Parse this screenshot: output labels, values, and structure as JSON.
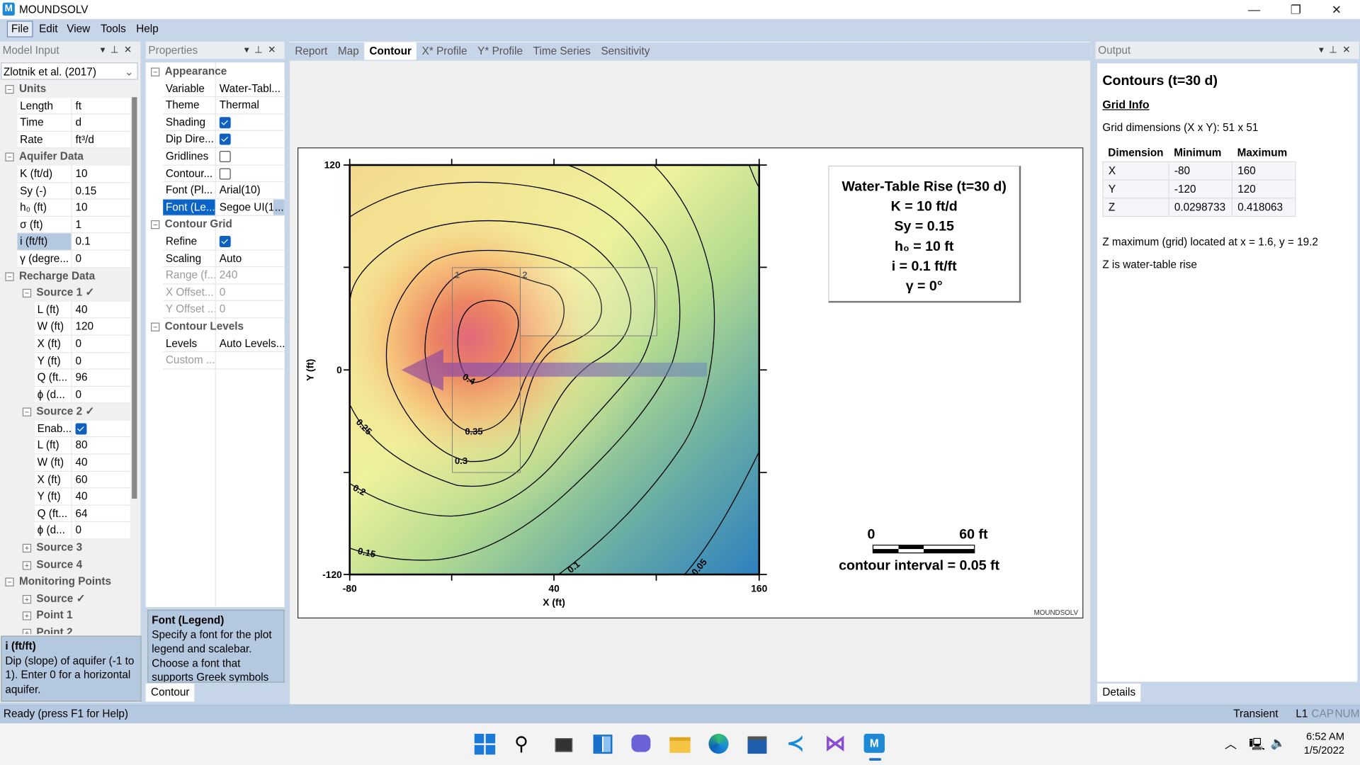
{
  "app": {
    "title": "MOUNDSOLV",
    "window_controls": [
      "minimize",
      "restore",
      "close"
    ]
  },
  "menu": [
    "File",
    "Edit",
    "View",
    "Tools",
    "Help"
  ],
  "model_input": {
    "header": "Model Input",
    "scenario": "Zlotnik et al. (2017)",
    "rows": [
      {
        "kind": "group",
        "depth": 0,
        "label": "Units",
        "expanded": true
      },
      {
        "kind": "prop",
        "depth": 1,
        "label": "Length",
        "value": "ft"
      },
      {
        "kind": "prop",
        "depth": 1,
        "label": "Time",
        "value": "d"
      },
      {
        "kind": "prop",
        "depth": 1,
        "label": "Rate",
        "value": "ft³/d"
      },
      {
        "kind": "group",
        "depth": 0,
        "label": "Aquifer Data",
        "expanded": true
      },
      {
        "kind": "prop",
        "depth": 1,
        "label": "K (ft/d)",
        "value": "10"
      },
      {
        "kind": "prop",
        "depth": 1,
        "label": "Sy (-)",
        "value": "0.15"
      },
      {
        "kind": "prop",
        "depth": 1,
        "label": "h₀ (ft)",
        "value": "10"
      },
      {
        "kind": "prop",
        "depth": 1,
        "label": "σ (ft)",
        "value": "1"
      },
      {
        "kind": "prop",
        "depth": 1,
        "label": "i (ft/ft)",
        "value": "0.1",
        "selected": true
      },
      {
        "kind": "prop",
        "depth": 1,
        "label": "γ (degre...",
        "value": "0"
      },
      {
        "kind": "group",
        "depth": 0,
        "label": "Recharge Data",
        "expanded": true
      },
      {
        "kind": "group",
        "depth": 1,
        "label": "Source 1 ✓",
        "expanded": true
      },
      {
        "kind": "prop",
        "depth": 2,
        "label": "L (ft)",
        "value": "40"
      },
      {
        "kind": "prop",
        "depth": 2,
        "label": "W (ft)",
        "value": "120"
      },
      {
        "kind": "prop",
        "depth": 2,
        "label": "X (ft)",
        "value": "0"
      },
      {
        "kind": "prop",
        "depth": 2,
        "label": "Y (ft)",
        "value": "0"
      },
      {
        "kind": "prop",
        "depth": 2,
        "label": "Q (ft...",
        "value": "96"
      },
      {
        "kind": "prop",
        "depth": 2,
        "label": "ϕ (d...",
        "value": "0"
      },
      {
        "kind": "group",
        "depth": 1,
        "label": "Source 2 ✓",
        "expanded": true
      },
      {
        "kind": "check",
        "depth": 2,
        "label": "Enab...",
        "checked": true
      },
      {
        "kind": "prop",
        "depth": 2,
        "label": "L (ft)",
        "value": "80"
      },
      {
        "kind": "prop",
        "depth": 2,
        "label": "W (ft)",
        "value": "40"
      },
      {
        "kind": "prop",
        "depth": 2,
        "label": "X (ft)",
        "value": "60"
      },
      {
        "kind": "prop",
        "depth": 2,
        "label": "Y (ft)",
        "value": "40"
      },
      {
        "kind": "prop",
        "depth": 2,
        "label": "Q (ft...",
        "value": "64"
      },
      {
        "kind": "prop",
        "depth": 2,
        "label": "ϕ (d...",
        "value": "0"
      },
      {
        "kind": "group",
        "depth": 1,
        "label": "Source 3",
        "expanded": false
      },
      {
        "kind": "group",
        "depth": 1,
        "label": "Source 4",
        "expanded": false
      },
      {
        "kind": "group",
        "depth": 0,
        "label": "Monitoring Points",
        "expanded": true
      },
      {
        "kind": "group",
        "depth": 1,
        "label": "Source ✓",
        "expanded": false
      },
      {
        "kind": "group",
        "depth": 1,
        "label": "Point 1",
        "expanded": false
      },
      {
        "kind": "group",
        "depth": 1,
        "label": "Point 2",
        "expanded": false
      }
    ],
    "description_title": "i (ft/ft)",
    "description": "Dip (slope) of aquifer (-1 to 1). Enter 0 for a horizontal aquifer."
  },
  "properties": {
    "header": "Properties",
    "rows": [
      {
        "kind": "group",
        "depth": 0,
        "label": "Appearance",
        "expanded": true
      },
      {
        "kind": "prop",
        "depth": 1,
        "label": "Variable",
        "value": "Water-Tabl..."
      },
      {
        "kind": "prop",
        "depth": 1,
        "label": "Theme",
        "value": "Thermal"
      },
      {
        "kind": "check",
        "depth": 1,
        "label": "Shading",
        "checked": true
      },
      {
        "kind": "check",
        "depth": 1,
        "label": "Dip Dire...",
        "checked": true
      },
      {
        "kind": "check",
        "depth": 1,
        "label": "Gridlines",
        "checked": false
      },
      {
        "kind": "check",
        "depth": 1,
        "label": "Contour...",
        "checked": false
      },
      {
        "kind": "prop",
        "depth": 1,
        "label": "Font (Pl...",
        "value": "Arial(10)"
      },
      {
        "kind": "prop",
        "depth": 1,
        "label": "Font (Le...",
        "value": "Segoe UI(1",
        "selected_blue": true,
        "button": "..."
      },
      {
        "kind": "group",
        "depth": 0,
        "label": "Contour Grid",
        "expanded": true
      },
      {
        "kind": "check",
        "depth": 1,
        "label": "Refine",
        "checked": true
      },
      {
        "kind": "prop",
        "depth": 1,
        "label": "Scaling",
        "value": "Auto"
      },
      {
        "kind": "prop",
        "depth": 1,
        "label": "Range (f...",
        "value": "240",
        "disabled": true
      },
      {
        "kind": "prop",
        "depth": 1,
        "label": "X Offset...",
        "value": "0",
        "disabled": true
      },
      {
        "kind": "prop",
        "depth": 1,
        "label": "Y Offset ...",
        "value": "0",
        "disabled": true
      },
      {
        "kind": "group",
        "depth": 0,
        "label": "Contour Levels",
        "expanded": true
      },
      {
        "kind": "prop",
        "depth": 1,
        "label": "Levels",
        "value": "Auto Levels..."
      },
      {
        "kind": "prop",
        "depth": 1,
        "label": "Custom ...",
        "value": "",
        "disabled": true
      }
    ],
    "description_title": "Font (Legend)",
    "description": "Specify a font for the plot legend and scalebar. Choose a font that supports Greek symbols (default is",
    "bottom_tab": "Contour"
  },
  "document_tabs": [
    {
      "label": "Report",
      "active": false
    },
    {
      "label": "Map",
      "active": false
    },
    {
      "label": "Contour",
      "active": true
    },
    {
      "label": "X* Profile",
      "active": false
    },
    {
      "label": "Y* Profile",
      "active": false
    },
    {
      "label": "Time Series",
      "active": false
    },
    {
      "label": "Sensitivity",
      "active": false
    }
  ],
  "chart_data": {
    "type": "contour",
    "xlabel": "X (ft)",
    "ylabel": "Y (ft)",
    "xlim": [
      -80,
      160
    ],
    "ylim": [
      -120,
      120
    ],
    "x_tick_labels": [
      "-80",
      "40",
      "160"
    ],
    "y_tick_labels": [
      "120",
      "0",
      "-120"
    ],
    "contour_levels": [
      0.05,
      0.1,
      0.15,
      0.2,
      0.25,
      0.3,
      0.35,
      0.4
    ],
    "contour_labels": [
      "0.4",
      "0.35",
      "0.3",
      "0.25",
      "0.2",
      "0.15",
      "0.1",
      "0.05"
    ],
    "z_max_location": {
      "x": 1.6,
      "y": 19.2
    },
    "z_range": [
      0.0298733,
      0.418063
    ],
    "colormap": "Thermal",
    "shading": true,
    "gridlines": false,
    "sources": [
      {
        "label": "1",
        "x_range": [
          -20,
          20
        ],
        "y_range": [
          -60,
          60
        ]
      },
      {
        "label": "2",
        "x_range": [
          20,
          100
        ],
        "y_range": [
          20,
          60
        ]
      }
    ],
    "dip_direction": "toward -x (arrow along y = 0)",
    "legend": {
      "lines": [
        "Water-Table Rise (t=30 d)",
        "K = 10 ft/d",
        "Sy = 0.15",
        "h₀ = 10 ft",
        "i = 0.1 ft/ft",
        "γ = 0°"
      ],
      "placement": "top-right"
    },
    "scalebar": {
      "start": "0",
      "end": "60 ft"
    },
    "contour_interval_text": "contour interval = 0.05 ft",
    "watermark": "MOUNDSOLV"
  },
  "output": {
    "header": "Output",
    "title": "Contours (t=30 d)",
    "section": "Grid Info",
    "grid_dims": "Grid dimensions (X x Y): 51 x 51",
    "table": {
      "headers": [
        "Dimension",
        "Minimum",
        "Maximum"
      ],
      "rows": [
        [
          "X",
          "-80",
          "160"
        ],
        [
          "Y",
          "-120",
          "120"
        ],
        [
          "Z",
          "0.0298733",
          "0.418063"
        ]
      ]
    },
    "zmax_text": "Z maximum (grid) located at x = 1.6, y = 19.2",
    "z_note": "Z is water-table rise",
    "bottom_tab": "Details"
  },
  "status": {
    "text": "Ready (press F1 for Help)",
    "mode": "Transient",
    "indicators": [
      "L1",
      "CAP",
      "NUM"
    ]
  },
  "taskbar": {
    "icons": [
      "windows-start-icon",
      "search-icon",
      "task-view-icon",
      "widgets-icon",
      "chat-icon",
      "file-explorer-icon",
      "edge-icon",
      "store-icon",
      "vscode-icon",
      "visual-studio-icon",
      "moundsolv-icon"
    ],
    "time": "6:52 AM",
    "date": "1/5/2022"
  },
  "colors": {
    "accent": "#0a64c8",
    "chrome": "#c7d5e8",
    "selection": "#b4c8e0"
  }
}
